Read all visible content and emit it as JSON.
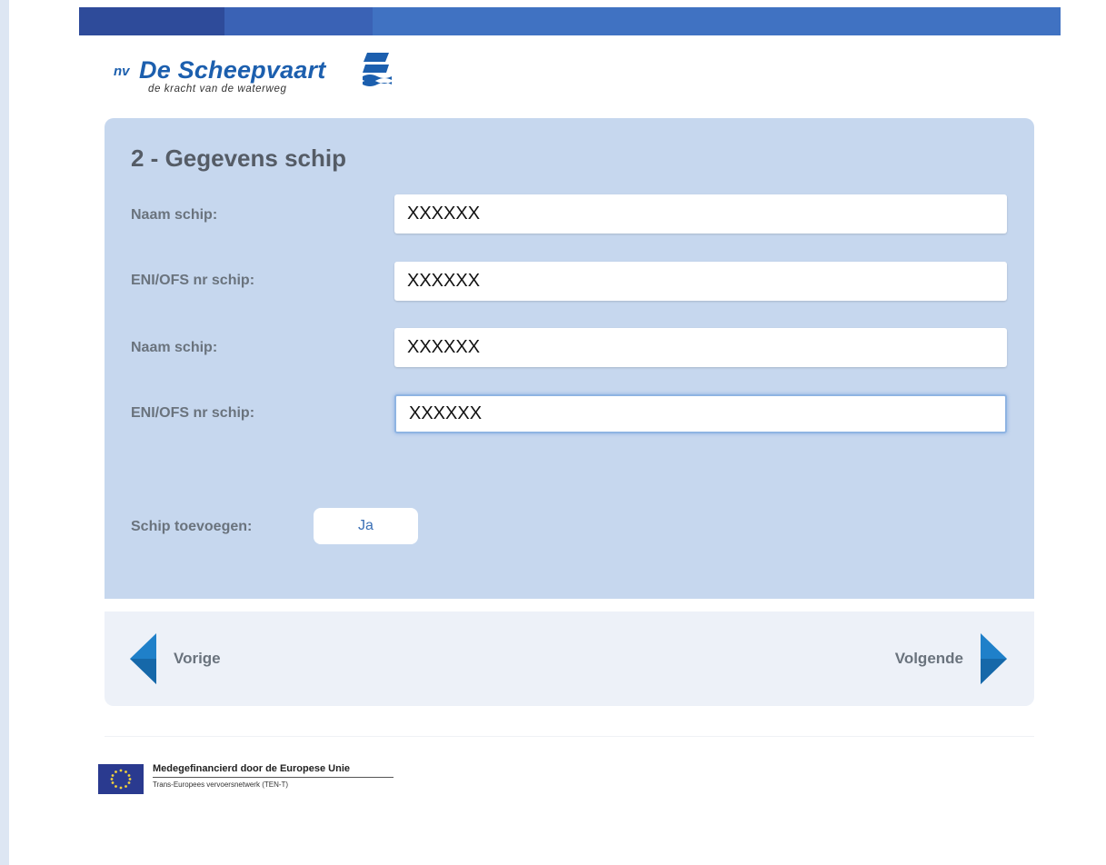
{
  "brand": {
    "prefix": "nv",
    "name": "De Scheepvaart",
    "tagline": "de kracht van de waterweg"
  },
  "form": {
    "title": "2 - Gegevens schip",
    "fields": [
      {
        "label": "Naam schip:",
        "value": "XXXXXX"
      },
      {
        "label": "ENI/OFS nr schip:",
        "value": "XXXXXX"
      },
      {
        "label": "Naam schip:",
        "value": "XXXXXX"
      },
      {
        "label": "ENI/OFS nr schip:",
        "value": "XXXXXX"
      }
    ],
    "add_ship_label": "Schip toevoegen:",
    "add_ship_button": "Ja"
  },
  "navigation": {
    "prev_label": "Vorige",
    "next_label": "Volgende"
  },
  "footer": {
    "eu_line1": "Medegefinancierd door de Europese Unie",
    "eu_line2": "Trans-Europees vervoersnetwerk (TEN-T)"
  },
  "colors": {
    "topbar_dark": "#2e4b9a",
    "topbar_mid": "#3a62b5",
    "topbar_light": "#4072c2",
    "panel_bg": "#c6d7ee",
    "brand_blue": "#1c5fae",
    "arrow_blue": "#1f80c9"
  }
}
